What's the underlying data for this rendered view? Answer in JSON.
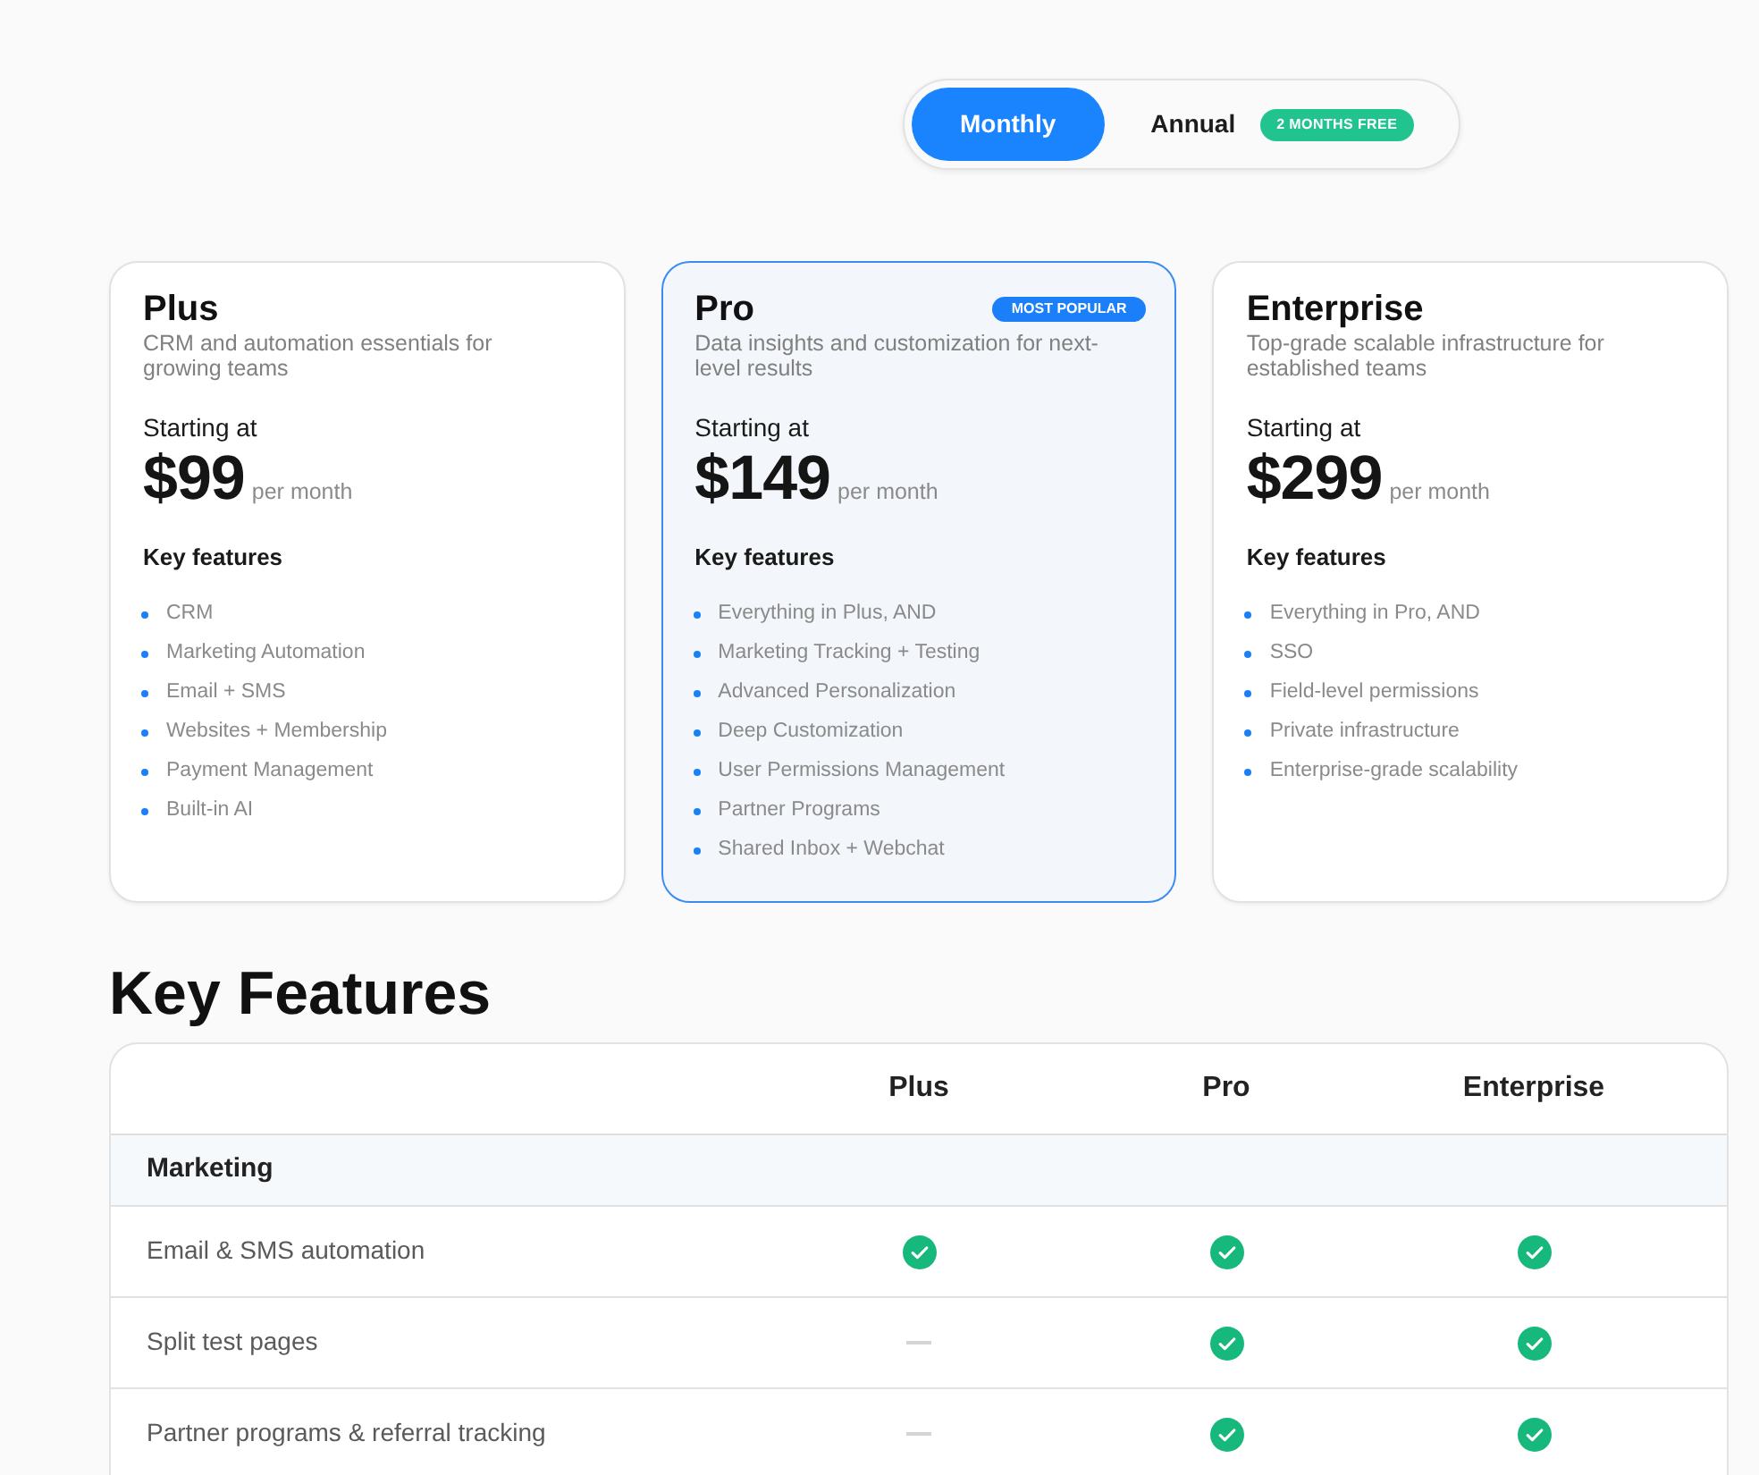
{
  "billing_toggle": {
    "options": [
      {
        "label": "Monthly",
        "selected": true
      },
      {
        "label": "Annual",
        "selected": false,
        "badge": "2 MONTHS FREE"
      }
    ]
  },
  "plans": [
    {
      "name": "Plus",
      "highlighted": false,
      "description": "CRM and automation essentials for growing teams",
      "starting_label": "Starting at",
      "price": "$99",
      "period": "per month",
      "features_title": "Key features",
      "features": [
        "CRM",
        "Marketing Automation",
        "Email + SMS",
        "Websites + Membership",
        "Payment Management",
        "Built-in AI"
      ]
    },
    {
      "name": "Pro",
      "highlighted": true,
      "badge": "MOST POPULAR",
      "description": "Data insights and customization for next-level results",
      "starting_label": "Starting at",
      "price": "$149",
      "period": "per month",
      "features_title": "Key features",
      "features": [
        "Everything in Plus, AND",
        "Marketing Tracking + Testing",
        "Advanced Personalization",
        "Deep Customization",
        "User Permissions Management",
        "Partner Programs",
        "Shared Inbox + Webchat"
      ]
    },
    {
      "name": "Enterprise",
      "highlighted": false,
      "description": "Top-grade scalable infrastructure for established teams",
      "starting_label": "Starting at",
      "price": "$299",
      "period": "per month",
      "features_title": "Key features",
      "features": [
        "Everything in Pro, AND",
        "SSO",
        "Field-level permissions",
        "Private infrastructure",
        "Enterprise-grade scalability"
      ]
    }
  ],
  "features_heading": "Key Features",
  "comparison_table": {
    "columns": [
      "Plus",
      "Pro",
      "Enterprise"
    ],
    "sections": [
      {
        "title": "Marketing",
        "rows": [
          {
            "feature": "Email & SMS automation",
            "included": [
              true,
              true,
              true
            ]
          },
          {
            "feature": "Split test pages",
            "included": [
              false,
              true,
              true
            ]
          },
          {
            "feature": "Partner programs & referral tracking",
            "included": [
              false,
              true,
              true
            ]
          }
        ]
      }
    ]
  }
}
